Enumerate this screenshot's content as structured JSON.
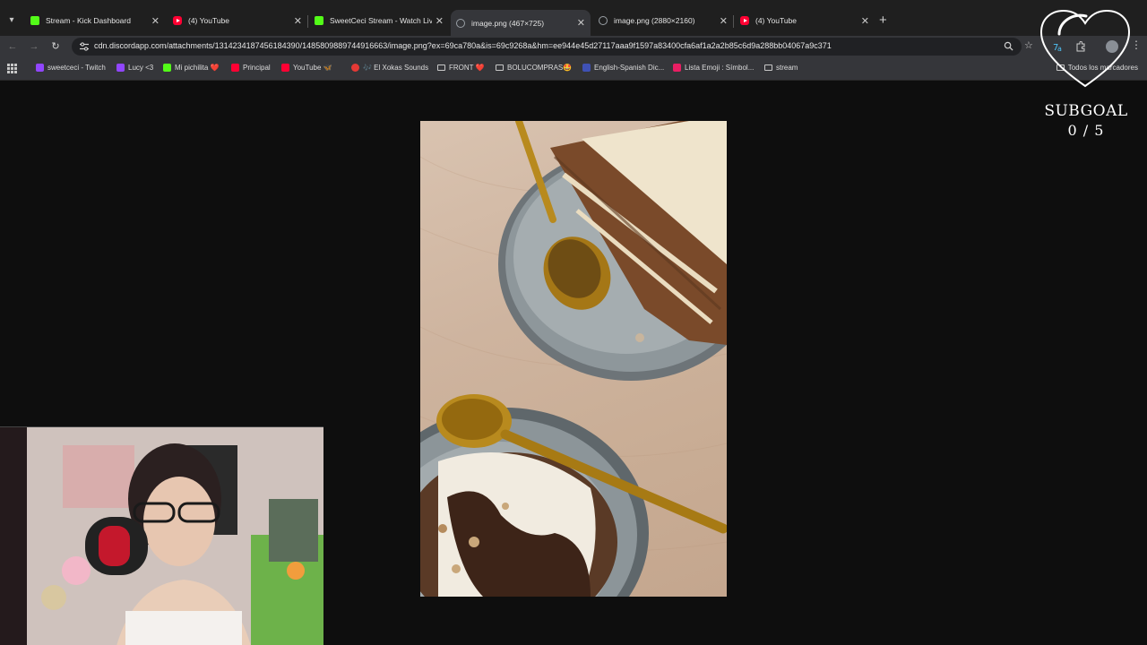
{
  "tabs": [
    {
      "title": "Stream - Kick Dashboard",
      "favicon": "kick-icon",
      "active": false
    },
    {
      "title": "(4) YouTube",
      "favicon": "youtube-icon",
      "active": false
    },
    {
      "title": "SweetCeci Stream - Watch Live",
      "favicon": "kick-icon",
      "active": false
    },
    {
      "title": "image.png (467×725)",
      "favicon": "globe-icon",
      "active": true
    },
    {
      "title": "image.png (2880×2160)",
      "favicon": "globe-icon",
      "active": false
    },
    {
      "title": "(4) YouTube",
      "favicon": "youtube-icon",
      "active": false
    }
  ],
  "toolbar": {
    "url": "cdn.discordapp.com/attachments/1314234187456184390/1485809889744916663/image.png?ex=69ca780a&is=69c9268a&hm=ee944e45d27117aaa9f1597a83400cfa6af1a2a2b85c6d9a288bb04067a9c371"
  },
  "bookmarks": [
    {
      "label": "sweetceci - Twitch",
      "favicon": "twitch-icon"
    },
    {
      "label": "Lucy <3",
      "favicon": "twitch-icon"
    },
    {
      "label": "Mi pichilita ❤️",
      "favicon": "kick-icon"
    },
    {
      "label": "Principal",
      "favicon": "youtube-icon"
    },
    {
      "label": "YouTube 🦋",
      "favicon": "youtube-icon"
    },
    {
      "label": "🎶 El Xokas Sounds",
      "favicon": "red-dot-icon"
    },
    {
      "label": "FRONT ❤️",
      "favicon": "folder-icon"
    },
    {
      "label": "BOLUCOMPRAS🤩",
      "favicon": "folder-icon"
    },
    {
      "label": "English-Spanish Dic...",
      "favicon": "k-icon"
    },
    {
      "label": "Lista Emoji : Símbol...",
      "favicon": "flash-icon"
    },
    {
      "label": "stream",
      "favicon": "folder-icon"
    }
  ],
  "all_bookmarks_label": "Todos los marcadores",
  "overlay": {
    "subgoal_label": "SUBGOAL",
    "subgoal_count": "0 / 5"
  },
  "colors": {
    "page_bg": "#0e0e0e",
    "tabstrip_bg": "#1f1f1f",
    "toolbar_bg": "#35363a",
    "omnibox_bg": "#202124",
    "kick_green": "#53fc18",
    "youtube_red": "#ff0033",
    "twitch_purple": "#9146ff"
  }
}
